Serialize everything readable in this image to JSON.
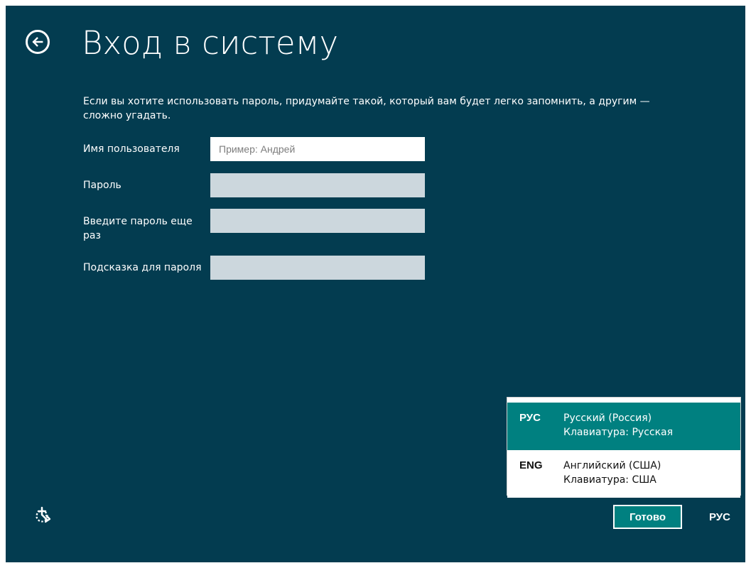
{
  "header": {
    "title": "Вход в систему",
    "back_icon": "back-arrow-icon"
  },
  "description": "Если вы хотите использовать пароль, придумайте такой, который вам будет легко запомнить, а другим — сложно угадать.",
  "form": {
    "username": {
      "label": "Имя пользователя",
      "placeholder": "Пример: Андрей",
      "value": ""
    },
    "password": {
      "label": "Пароль",
      "value": ""
    },
    "repeat_password": {
      "label": "Введите пароль еще раз",
      "value": ""
    },
    "password_hint": {
      "label": "Подсказка для пароля",
      "value": ""
    }
  },
  "language_menu": {
    "items": [
      {
        "code": "РУС",
        "language": "Русский (Россия)",
        "keyboard": "Клавиатура: Русская",
        "selected": true
      },
      {
        "code": "ENG",
        "language": "Английский (США)",
        "keyboard": "Клавиатура: США",
        "selected": false
      }
    ]
  },
  "footer": {
    "done_label": "Готово",
    "language_indicator": "РУС",
    "accessibility_icon": "ease-of-access-icon"
  },
  "colors": {
    "background": "#033c50",
    "accent": "#008080",
    "input_disabled": "#ccd7dd",
    "popup_background": "#ffffff"
  }
}
